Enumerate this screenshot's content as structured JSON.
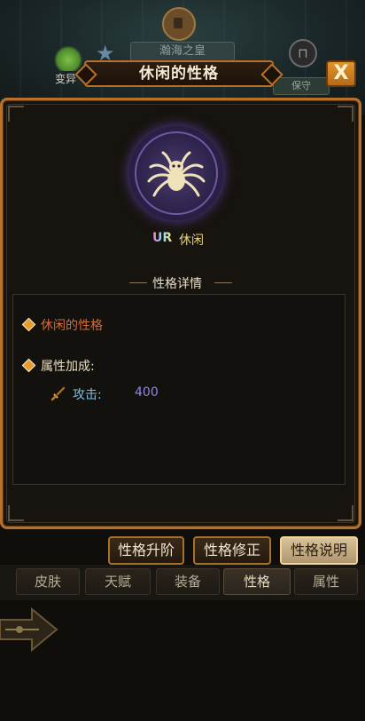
{
  "background": {
    "top_title": "瀚海之皇",
    "mutation_label": "变异",
    "keep_label": "保守"
  },
  "dialog": {
    "title": "休闲的性格",
    "close_label": "X",
    "rarity": "UR",
    "persona_name": "休闲",
    "section_header": "性格详情",
    "detail": {
      "personality_label": "休闲的性格",
      "bonus_label": "属性加成:",
      "stat_name": "攻击:",
      "stat_value": "400"
    }
  },
  "actions": [
    {
      "label": "性格升阶"
    },
    {
      "label": "性格修正"
    },
    {
      "label": "性格说明"
    }
  ],
  "tabs": [
    {
      "label": "皮肤"
    },
    {
      "label": "天赋"
    },
    {
      "label": "装备"
    },
    {
      "label": "性格"
    },
    {
      "label": "属性"
    }
  ],
  "colors": {
    "accent": "#b9702a",
    "personality_text": "#d96a3a",
    "bonus_text": "#e8dcc0",
    "stat_value": "#8f86e6",
    "stat_name": "#78c2e6"
  }
}
